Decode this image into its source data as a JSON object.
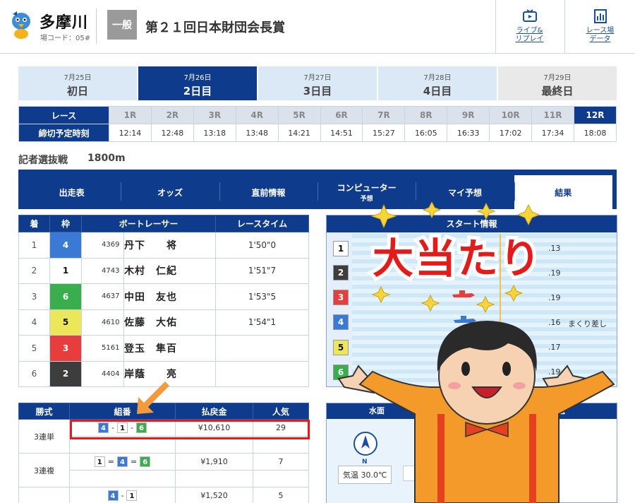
{
  "header": {
    "venue_name": "多摩川",
    "venue_code": "場コード：05#",
    "grade": "一般",
    "race_title": "第２１回日本財団会長賞",
    "btn_live_1": "ライブ&",
    "btn_live_2": "リプレイ",
    "btn_data_1": "レース場",
    "btn_data_2": "データ"
  },
  "days": [
    {
      "date": "7月25日",
      "label": "初日"
    },
    {
      "date": "7月26日",
      "label": "2日目"
    },
    {
      "date": "7月27日",
      "label": "3日目"
    },
    {
      "date": "7月28日",
      "label": "4日目"
    },
    {
      "date": "7月29日",
      "label": "最終日"
    }
  ],
  "race_table": {
    "race_label": "レース",
    "time_label": "締切予定時刻",
    "races": [
      "1R",
      "2R",
      "3R",
      "4R",
      "5R",
      "6R",
      "7R",
      "8R",
      "9R",
      "10R",
      "11R",
      "12R"
    ],
    "times": [
      "12:14",
      "12:48",
      "13:18",
      "13:48",
      "14:21",
      "14:51",
      "15:27",
      "16:05",
      "16:33",
      "17:02",
      "17:34",
      "18:08"
    ]
  },
  "race_info": {
    "name": "記者選抜戦",
    "distance": "1800m"
  },
  "nav": {
    "entry": "出走表",
    "odds": "オッズ",
    "before": "直前情報",
    "computer_1": "コンピューター",
    "computer_2": "予想",
    "my": "マイ予想",
    "result": "結果"
  },
  "results": {
    "headers": {
      "rank": "着",
      "frame": "枠",
      "racer": "ボートレーサー",
      "time": "レースタイム"
    },
    "rows": [
      {
        "rank": "1",
        "frame": "4",
        "id": "4369",
        "name": "丹下　　将",
        "time": "1'50\"0"
      },
      {
        "rank": "2",
        "frame": "1",
        "id": "4743",
        "name": "木村　仁紀",
        "time": "1'51\"7"
      },
      {
        "rank": "3",
        "frame": "6",
        "id": "4637",
        "name": "中田　友也",
        "time": "1'53\"5"
      },
      {
        "rank": "4",
        "frame": "5",
        "id": "4610",
        "name": "佐藤　大佑",
        "time": "1'54\"1"
      },
      {
        "rank": "5",
        "frame": "3",
        "id": "5161",
        "name": "登玉　隼百",
        "time": ""
      },
      {
        "rank": "6",
        "frame": "2",
        "id": "4404",
        "name": "岸蔭　　亮",
        "time": ""
      }
    ]
  },
  "start_info": {
    "title": "スタート情報",
    "rows": [
      {
        "lane": "1",
        "st": ".13",
        "comment": ""
      },
      {
        "lane": "2",
        "st": ".19",
        "comment": ""
      },
      {
        "lane": "3",
        "st": ".19",
        "comment": ""
      },
      {
        "lane": "4",
        "st": ".16",
        "comment": "まくり差し"
      },
      {
        "lane": "5",
        "st": ".17",
        "comment": ""
      },
      {
        "lane": "6",
        "st": ".19",
        "comment": ""
      }
    ]
  },
  "payout": {
    "headers": {
      "type": "勝式",
      "combo": "組番",
      "amount": "払戻金",
      "pop": "人気"
    },
    "rows": [
      {
        "type": "3連単",
        "c": [
          "4",
          "1",
          "6"
        ],
        "sep": "-",
        "amount": "¥10,610",
        "pop": "29"
      },
      {
        "type": "3連複",
        "c": [
          "1",
          "4",
          "6"
        ],
        "sep": "=",
        "amount": "¥1,910",
        "pop": "7"
      },
      {
        "type": "",
        "c": [
          "4",
          "1"
        ],
        "sep": "-",
        "amount": "¥1,520",
        "pop": "5"
      }
    ]
  },
  "weather": {
    "title_left": "水面",
    "title_right": "返還",
    "compass_dir": "N",
    "temp": "気温 30.0℃"
  },
  "overlay": {
    "text": "大当たり"
  },
  "colors": {
    "navy": "#0f3b8c",
    "highlight": "#e21c1c",
    "arrow": "#f39a3c"
  }
}
